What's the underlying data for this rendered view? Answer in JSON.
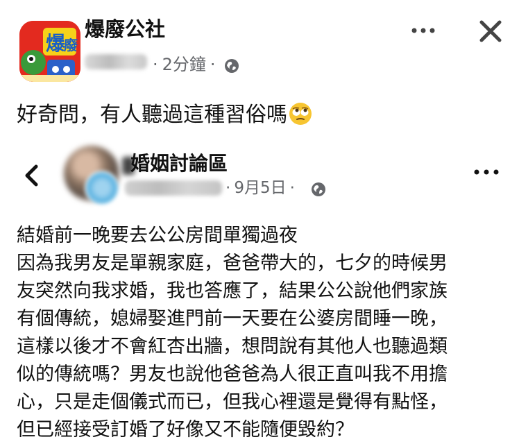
{
  "post": {
    "group_name": "爆廢公社",
    "time_ago": "2分鐘",
    "dot": "·",
    "privacy_icon": "globe-icon",
    "more_icon": "more-dots-icon",
    "close_icon": "close-icon",
    "text": "好奇問，有人聽過這種習俗嗎",
    "emoji": "face-with-rolling-eyes"
  },
  "shared_post": {
    "back_icon": "chevron-left-icon",
    "group_name": "婚姻討論區",
    "date": "9月5日",
    "dot": "·",
    "privacy_icon": "globe-icon",
    "more_icon": "more-dots-icon",
    "lines": [
      "結婚前一晚要去公公房間單獨過夜",
      "因為我男友是單親家庭，爸爸帶大的，七夕的時候男",
      "友突然向我求婚，我也答應了，結果公公說他們家族",
      "有個傳統，媳婦娶進門前一天要在公婆房間睡一晚，",
      "這樣以後才不會紅杏出牆，想問說有其他人也聽過類",
      "似的傳統嗎？男友也說他爸爸為人很正直叫我不用擔",
      "心，只是走個儀式而已，但我心裡還是覺得有點怪，",
      "但已經接受訂婚了好像又不能隨便毀約？"
    ]
  },
  "colors": {
    "text": "#111111",
    "meta": "#65676b",
    "group_logo_bg": "#e32a1f"
  }
}
